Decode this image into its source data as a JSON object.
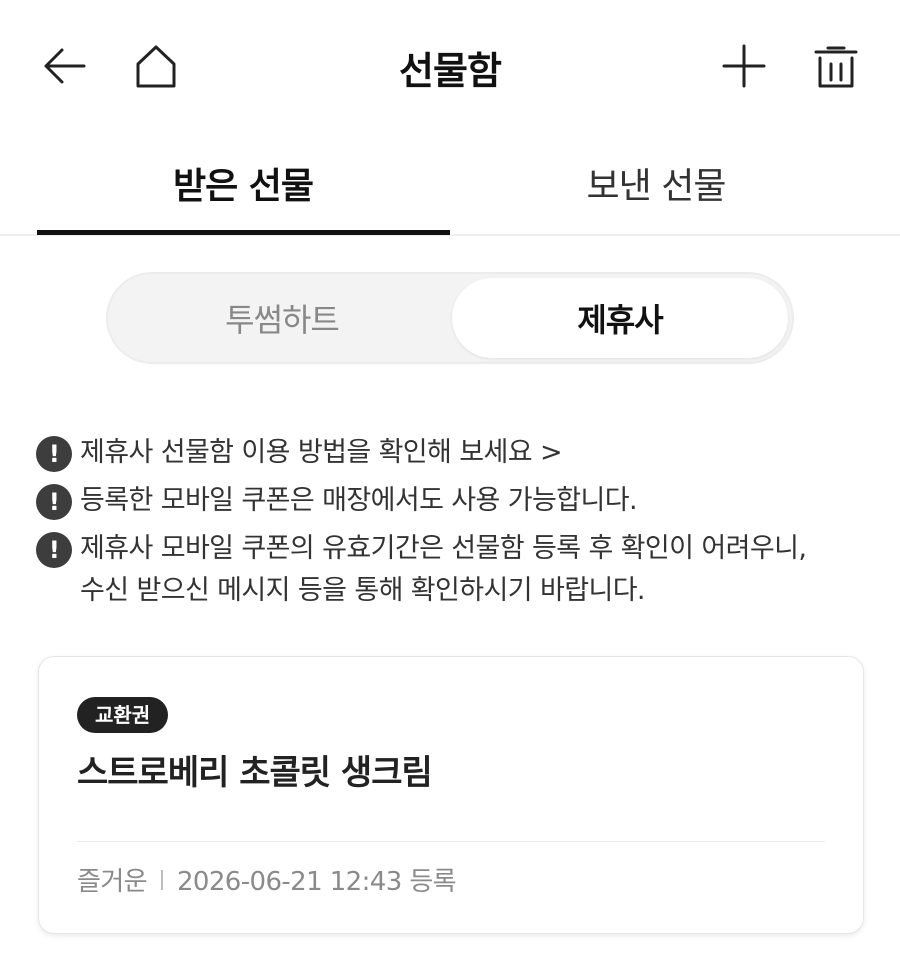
{
  "header": {
    "title": "선물함",
    "icons": [
      "arrow-left-icon",
      "home-icon",
      "plus-icon",
      "trash-icon"
    ]
  },
  "tabs": [
    {
      "label": "받은 선물",
      "active": true
    },
    {
      "label": "보낸 선물",
      "active": false
    }
  ],
  "segment": [
    {
      "label": "투썸하트",
      "active": false
    },
    {
      "label": "제휴사",
      "active": true
    }
  ],
  "notices": [
    {
      "lines": [
        "제휴사 선물함 이용 방법을 확인해 보세요 >"
      ]
    },
    {
      "lines": [
        "등록한 모바일 쿠폰은 매장에서도 사용 가능합니다."
      ]
    },
    {
      "lines": [
        "제휴사 모바일 쿠폰의 유효기간은 선물함 등록 후 확인이 어려우니,",
        "수신 받으신 메시지 등을 통해 확인하시기 바랍니다."
      ]
    }
  ],
  "card": {
    "badge": "교환권",
    "product": "스트로베리 초콜릿 생크림",
    "sender": "즐거운",
    "date": "2026-06-21 12:43 등록"
  },
  "colors": {
    "text": "#222222",
    "muted": "#8a8a8a",
    "badge_bg": "#222222",
    "segment_bg": "#f3f3f3"
  }
}
